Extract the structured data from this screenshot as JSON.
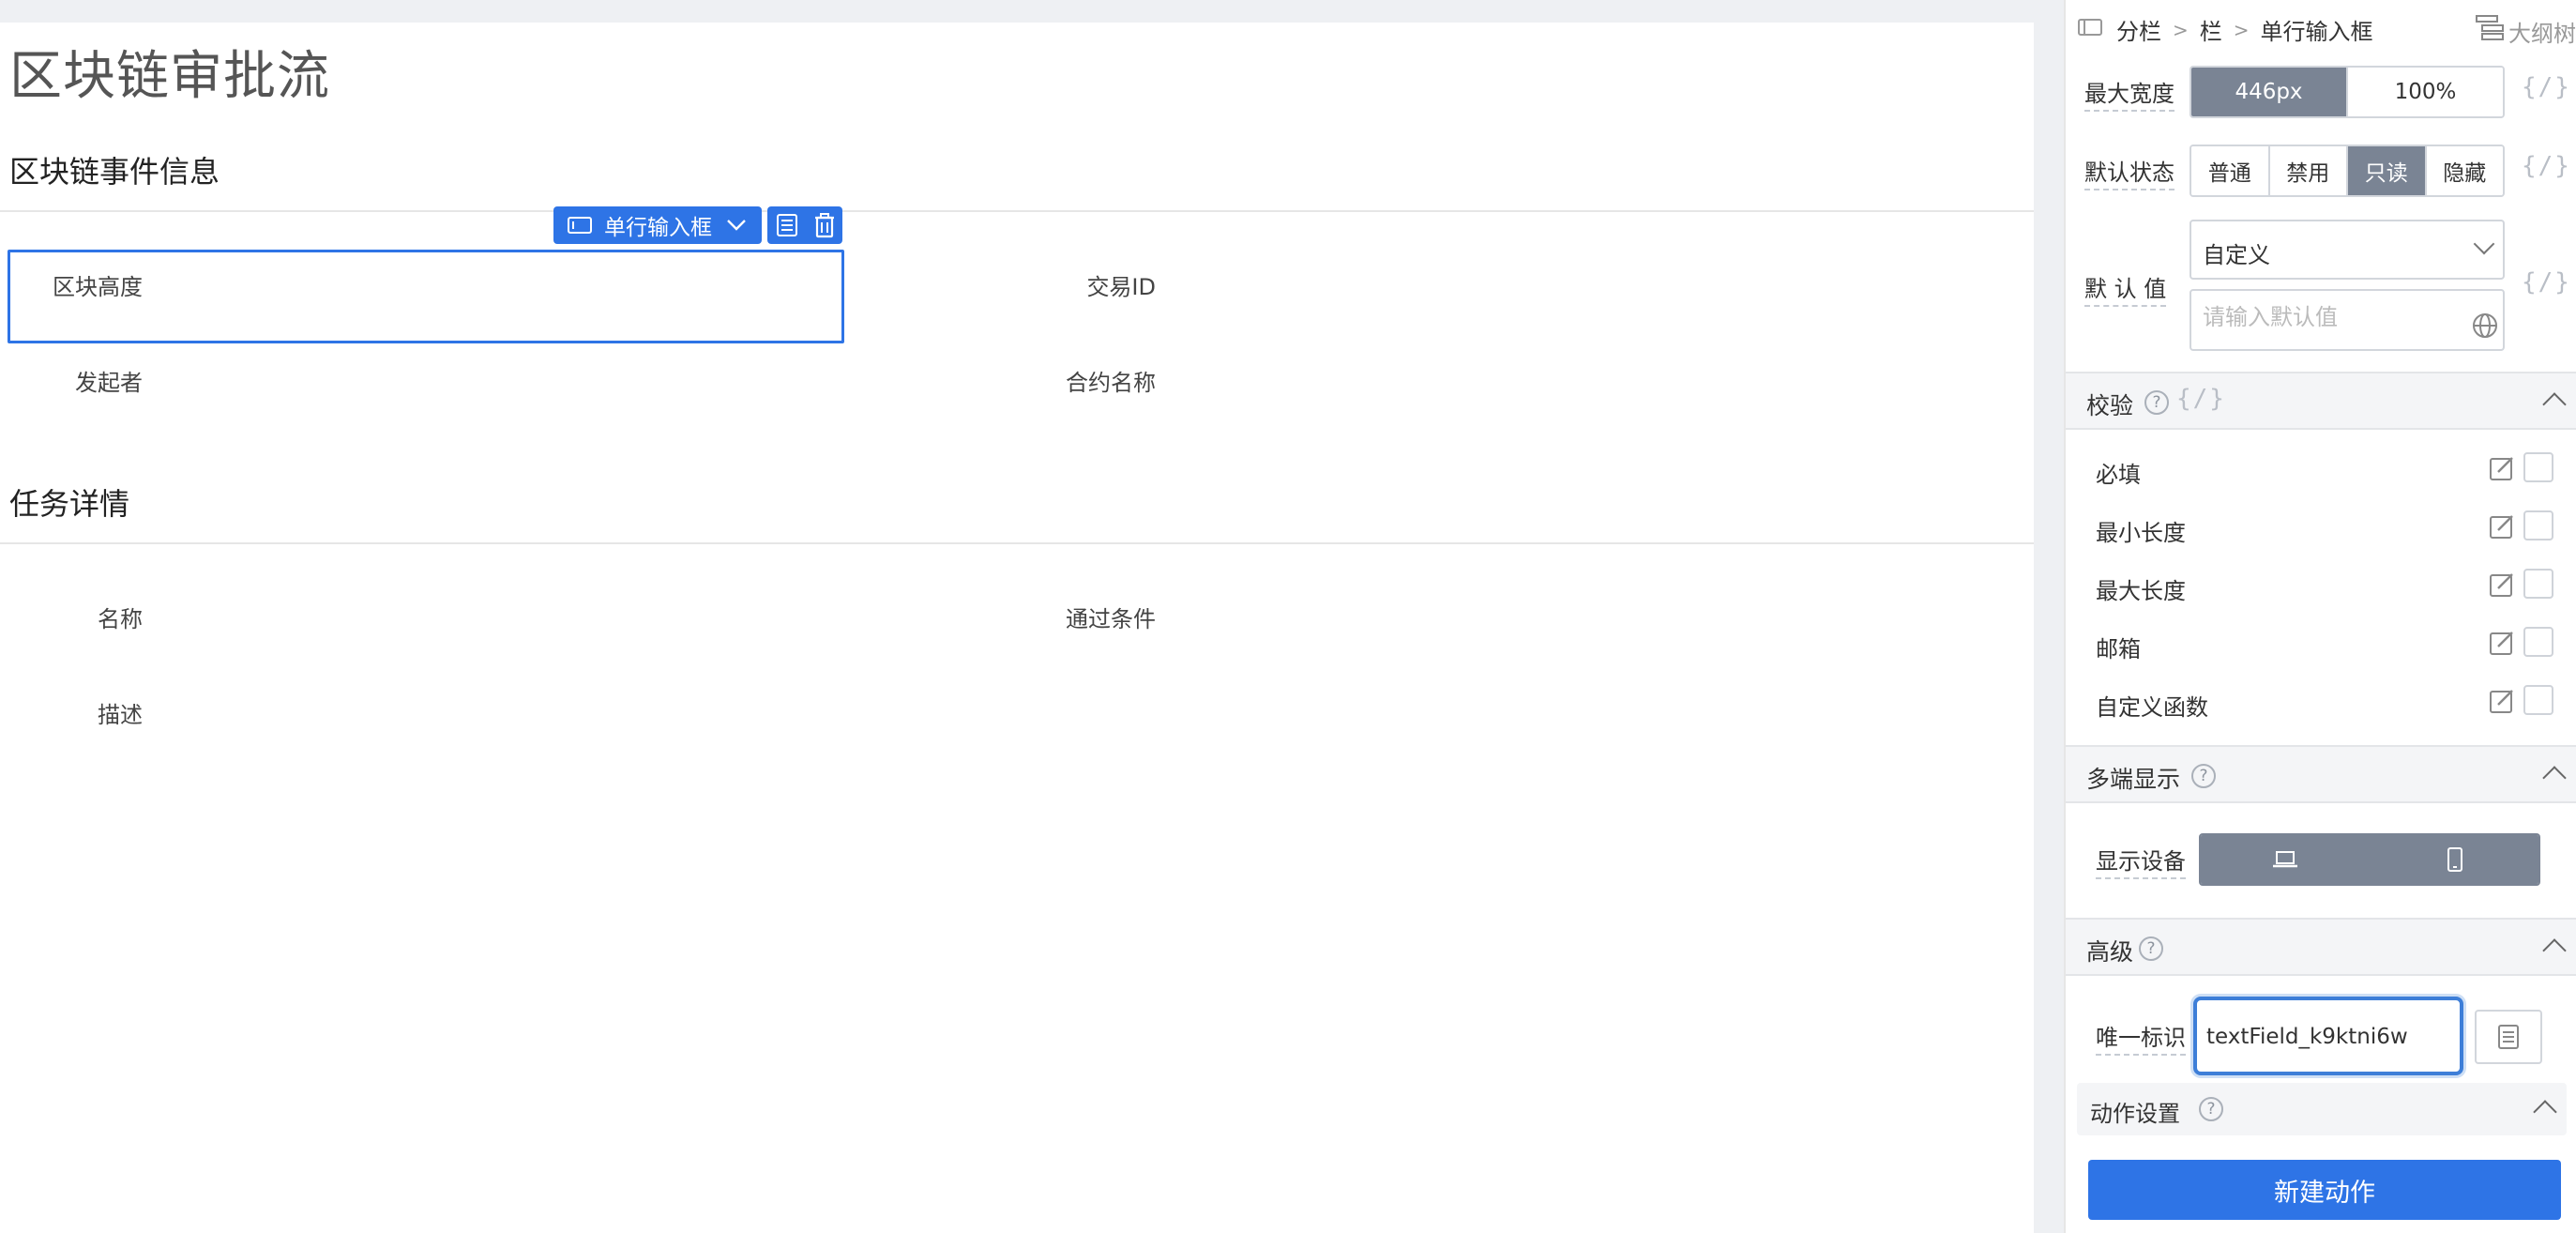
{
  "canvas": {
    "title": "区块链审批流",
    "section1": {
      "title": "区块链事件信息",
      "fields": {
        "block_height": "区块高度",
        "tx_id": "交易ID",
        "initiator": "发起者",
        "contract": "合约名称"
      }
    },
    "section2": {
      "title": "任务详情",
      "fields": {
        "name": "名称",
        "pass_condition": "通过条件",
        "description": "描述"
      }
    },
    "selection_toolbar": {
      "type_label": "单行输入框"
    }
  },
  "panel": {
    "breadcrumb": {
      "root": "分栏",
      "sep": ">",
      "mid": "栏",
      "leaf": "单行输入框",
      "outline": "大纲树"
    },
    "max_width": {
      "label": "最大宽度",
      "options": [
        "446px",
        "100%"
      ],
      "active": "446px"
    },
    "default_state": {
      "label": "默认状态",
      "options": [
        "普通",
        "禁用",
        "只读",
        "隐藏"
      ],
      "active": "只读"
    },
    "default_value": {
      "label": "默 认 值",
      "mode": "自定义",
      "placeholder": "请输入默认值"
    },
    "fx_symbol": "{/}",
    "validation": {
      "title": "校验",
      "items": [
        "必填",
        "最小长度",
        "最大长度",
        "邮箱",
        "自定义函数"
      ]
    },
    "multi_device": {
      "title": "多端显示",
      "label": "显示设备"
    },
    "advanced": {
      "title": "高级",
      "id_label": "唯一标识",
      "id_value": "textField_k9ktni6w"
    },
    "actions": {
      "title": "动作设置",
      "new_button": "新建动作"
    }
  }
}
